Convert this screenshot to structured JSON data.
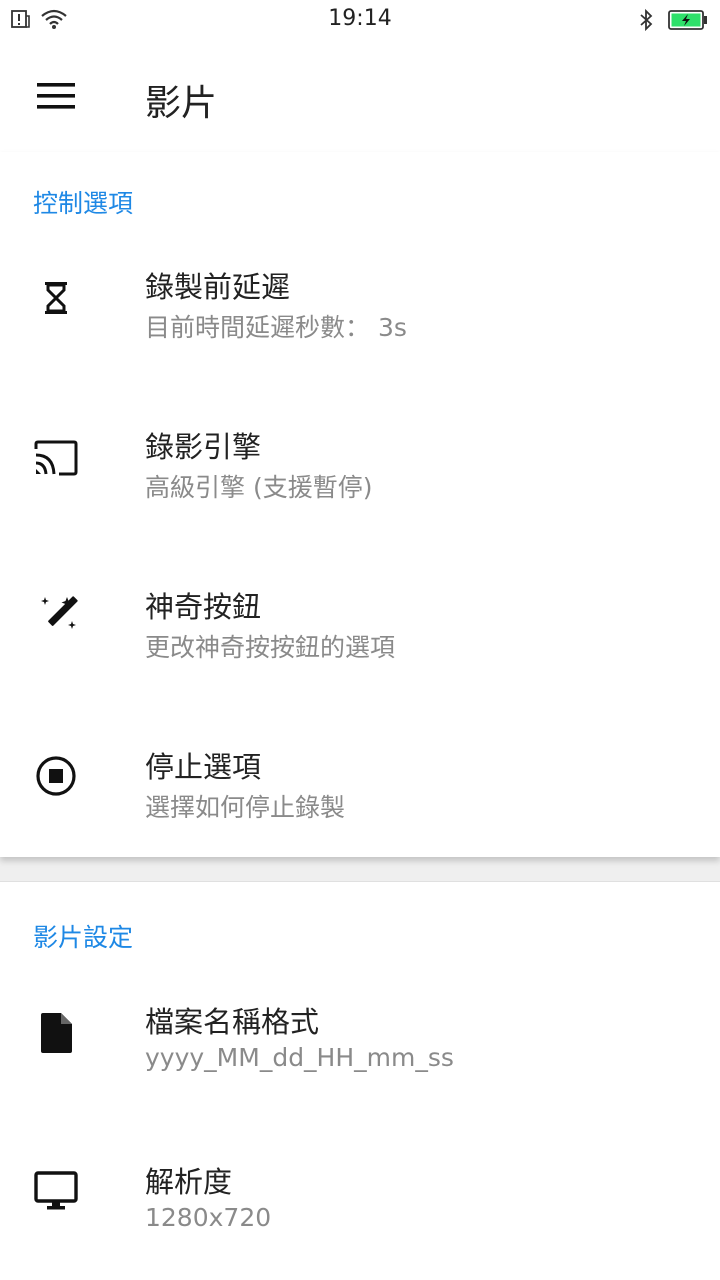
{
  "status_bar": {
    "time": "19:14",
    "icons_left": [
      "alert-icon",
      "wifi-icon"
    ],
    "icons_right": [
      "bluetooth-icon",
      "battery-charging-icon"
    ]
  },
  "app_bar": {
    "menu_icon": "hamburger-menu-icon",
    "title": "影片"
  },
  "sections": [
    {
      "header": "控制選項",
      "items": [
        {
          "icon": "hourglass-icon",
          "title": "錄製前延遲",
          "subtitle": "目前時間延遲秒數： 3s"
        },
        {
          "icon": "cast-icon",
          "title": "錄影引擎",
          "subtitle": "高級引擎 (支援暫停)"
        },
        {
          "icon": "magic-wand-icon",
          "title": "神奇按鈕",
          "subtitle": "更改神奇按按鈕的選項"
        },
        {
          "icon": "stop-circle-icon",
          "title": "停止選項",
          "subtitle": "選擇如何停止錄製"
        }
      ]
    },
    {
      "header": "影片設定",
      "items": [
        {
          "icon": "file-icon",
          "title": "檔案名稱格式",
          "subtitle": "yyyy_MM_dd_HH_mm_ss"
        },
        {
          "icon": "monitor-icon",
          "title": "解析度",
          "subtitle": "1280x720"
        }
      ]
    }
  ],
  "colors": {
    "accent": "#1e88e5",
    "title_text": "#222222",
    "subtitle_text": "#8a8a8a",
    "battery_fill": "#2ee06a"
  }
}
